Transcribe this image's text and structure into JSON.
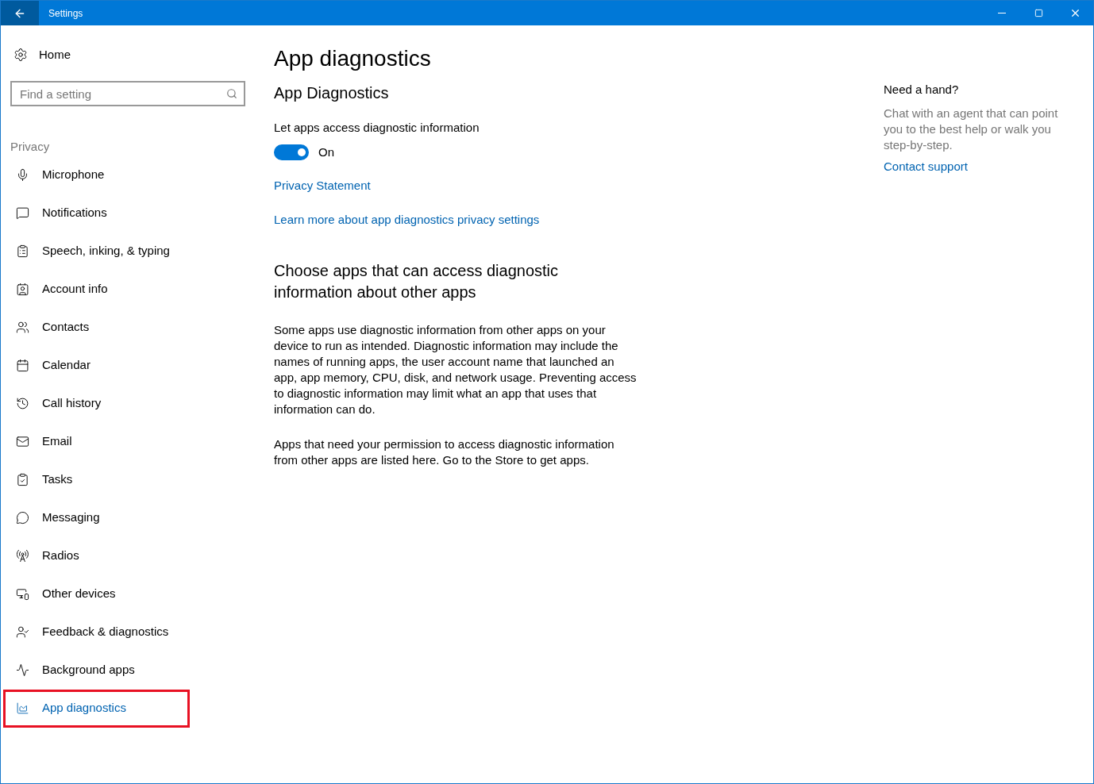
{
  "window": {
    "title": "Settings"
  },
  "sidebar": {
    "home": "Home",
    "search": {
      "placeholder": "Find a setting"
    },
    "section": "Privacy",
    "items": [
      {
        "label": "Microphone",
        "selected": false
      },
      {
        "label": "Notifications",
        "selected": false
      },
      {
        "label": "Speech, inking, & typing",
        "selected": false
      },
      {
        "label": "Account info",
        "selected": false
      },
      {
        "label": "Contacts",
        "selected": false
      },
      {
        "label": "Calendar",
        "selected": false
      },
      {
        "label": "Call history",
        "selected": false
      },
      {
        "label": "Email",
        "selected": false
      },
      {
        "label": "Tasks",
        "selected": false
      },
      {
        "label": "Messaging",
        "selected": false
      },
      {
        "label": "Radios",
        "selected": false
      },
      {
        "label": "Other devices",
        "selected": false
      },
      {
        "label": "Feedback & diagnostics",
        "selected": false
      },
      {
        "label": "Background apps",
        "selected": false
      },
      {
        "label": "App diagnostics",
        "selected": true
      }
    ]
  },
  "main": {
    "title": "App diagnostics",
    "subtitle": "App Diagnostics",
    "toggle_label": "Let apps access diagnostic information",
    "toggle": {
      "on": true,
      "label": "On"
    },
    "links": [
      "Privacy Statement",
      "Learn more about app diagnostics privacy settings"
    ],
    "section_title": "Choose apps that can access diagnostic information about other apps",
    "paragraphs": [
      "Some apps use diagnostic information from other apps on your device to run as intended. Diagnostic information may include the names of running apps, the user account name that launched an app, app memory, CPU, disk, and network usage. Preventing access to diagnostic information may limit what an app that uses that information can do.",
      "Apps that need your permission to access diagnostic information from other apps are listed here. Go to the Store to get apps."
    ]
  },
  "help": {
    "title": "Need a hand?",
    "text": "Chat with an agent that can point you to the best help or walk you step-by-step.",
    "link": "Contact support"
  }
}
